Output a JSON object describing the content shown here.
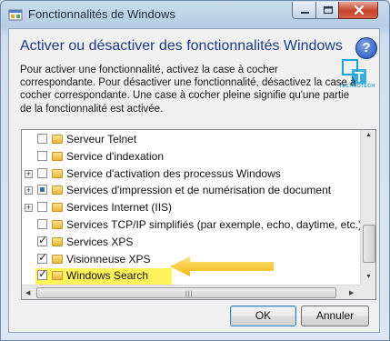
{
  "window": {
    "title": "Fonctionnalités de Windows",
    "heading": "Activer ou désactiver des fonctionnalités Windows",
    "help_icon_glyph": "?",
    "description": "Pour activer une fonctionnalité, activez la case à cocher correspondante. Pour désactiver une fonctionnalité, désactivez la case à cocher correspondante. Une case à cocher pleine signifie qu'une partie de la fonctionnalité est activée."
  },
  "logo": {
    "top": "TECHNO",
    "bottom": "TECH",
    "color": "#1aa3d9"
  },
  "features": [
    {
      "label": "Serveur Telnet",
      "state": "unchecked",
      "expandable": false
    },
    {
      "label": "Service d'indexation",
      "state": "unchecked",
      "expandable": false
    },
    {
      "label": "Service d'activation des processus Windows",
      "state": "unchecked",
      "expandable": true
    },
    {
      "label": "Services d'impression et de numérisation de document",
      "state": "partial",
      "expandable": true
    },
    {
      "label": "Services Internet (IIS)",
      "state": "unchecked",
      "expandable": true
    },
    {
      "label": "Services TCP/IP simplifiés (par exemple, echo, daytime, etc.)",
      "state": "unchecked",
      "expandable": false
    },
    {
      "label": "Services XPS",
      "state": "checked",
      "expandable": false
    },
    {
      "label": "Visionneuse XPS",
      "state": "checked",
      "expandable": false
    },
    {
      "label": "Windows Search",
      "state": "checked",
      "expandable": false,
      "highlighted": true
    }
  ],
  "buttons": {
    "ok": "OK",
    "cancel": "Annuler"
  },
  "colors": {
    "highlight": "#fff25a",
    "callout_arrow": "#f5c518",
    "heading": "#1e3b8a"
  }
}
